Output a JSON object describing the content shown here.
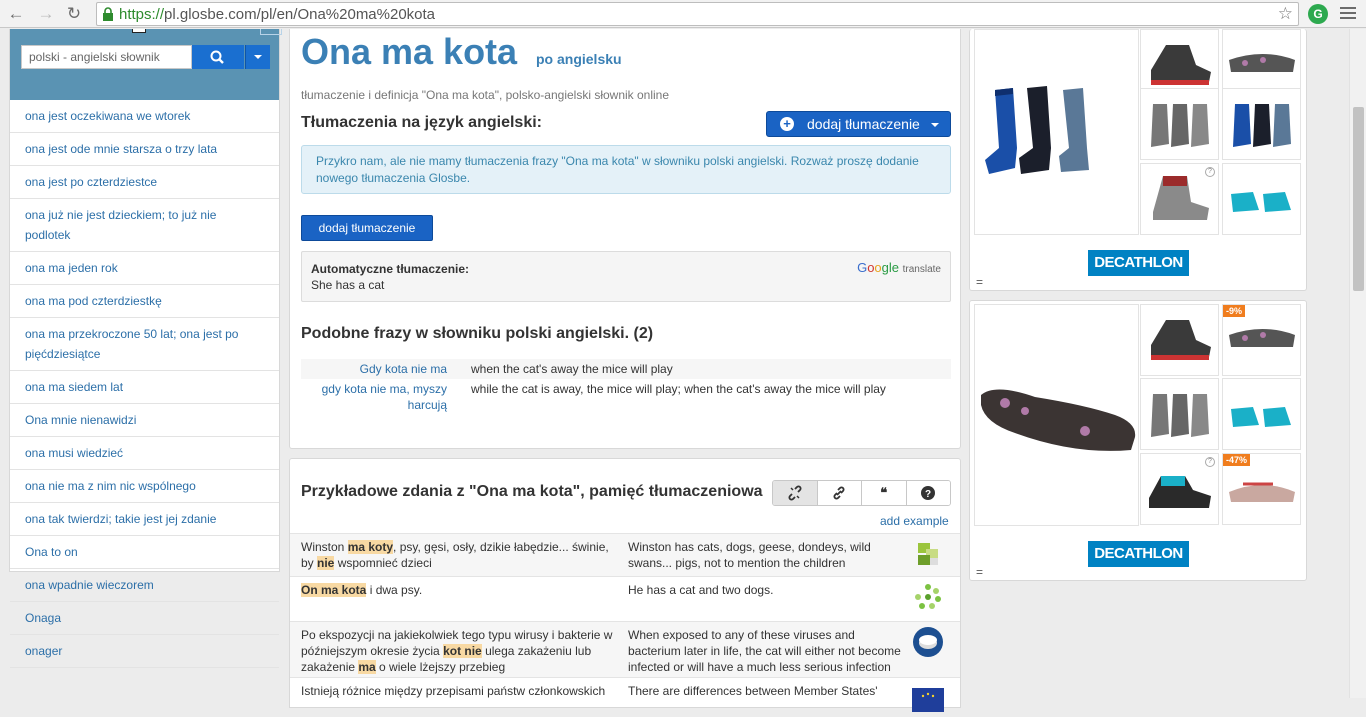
{
  "browser": {
    "url_scheme": "https://",
    "url_rest": "pl.glosbe.com/pl/en/Ona%20ma%20kota"
  },
  "sidebar": {
    "search_placeholder": "polski - angielski słownik",
    "items": [
      "ona jest oczekiwana we wtorek",
      "ona jest ode mnie starsza o trzy lata",
      "ona jest po czterdziestce",
      "ona już nie jest dzieckiem; to już nie podlotek",
      "ona ma jeden rok",
      "ona ma pod czterdziestkę",
      "ona ma przekroczone 50 lat; ona jest po pięćdziesiątce",
      "ona ma siedem lat",
      "Ona mnie nienawidzi",
      "ona musi wiedzieć",
      "ona nie ma z nim nic wspólnego",
      "ona tak twierdzi; takie jest jej zdanie",
      "Ona to on",
      "ona wpadnie wieczorem",
      "Onaga",
      "onager"
    ]
  },
  "main": {
    "headword": "Ona ma kota",
    "headword_sub": "po angielsku",
    "definition": "tłumaczenie i definicja \"Ona ma kota\", polsko-angielski słownik  online",
    "translations_title": "Tłumaczenia na język angielski:",
    "add_translation_label": "dodaj tłumaczenie",
    "info_message": "Przykro nam, ale nie mamy tłumaczenia frazy \"Ona ma kota\" w słowniku polski angielski. Rozważ proszę dodanie nowego tłumaczenia Glosbe.",
    "add_translation_small": "dodaj tłumaczenie",
    "auto_label": "Automatyczne tłumaczenie:",
    "auto_value": "She has a cat",
    "google_g1": "G",
    "google_g2": "o",
    "google_g3": "o",
    "google_g4": "gle",
    "google_translate": "translate",
    "similar_title": "Podobne frazy w słowniku polski angielski. (2)",
    "similar": [
      {
        "src": "Gdy kota nie ma",
        "tgt": "when the cat's away the mice will play"
      },
      {
        "src": "gdy kota nie ma, myszy harcują",
        "tgt": "while the cat is away, the mice will play; when the cat's away the mice will play"
      }
    ]
  },
  "examples": {
    "title": "Przykładowe zdania z \"Ona ma kota\", pamięć tłumaczeniowa",
    "tool_icons": [
      "unlink-icon",
      "link-icon",
      "quote-icon",
      "help-icon"
    ],
    "add_example": "add example",
    "rows": [
      {
        "src_parts": [
          "Winston ",
          "ma koty",
          ", psy, gęsi, osły, dzikie łabędzie... świnie, by ",
          "nie",
          " wspomnieć dzieci"
        ],
        "tgt": "Winston has cats, dogs, geese, dondeys, wild swans... pigs, not to mention the children"
      },
      {
        "src_parts": [
          "",
          "On ma kota",
          " i dwa psy."
        ],
        "tgt": "He has a cat and two dogs."
      },
      {
        "src_parts": [
          "Po ekspozycji na jakiekolwiek tego typu wirusy i bakterie w późniejszym okresie życia ",
          "kot nie",
          " ulega zakażeniu lub zakażenie ",
          "ma",
          " o wiele lżejszy przebieg"
        ],
        "tgt": "When exposed to any of these viruses and bacterium later in life, the cat will either not become infected or will have a much less serious infection"
      },
      {
        "src_parts": [
          "Istnieją różnice między przepisami państw członkowskich"
        ],
        "tgt": "There are differences between Member States'"
      }
    ]
  },
  "ads": {
    "brand": "DECATHLON",
    "discount1": "-9%",
    "discount2": "-47%",
    "eq": "="
  }
}
